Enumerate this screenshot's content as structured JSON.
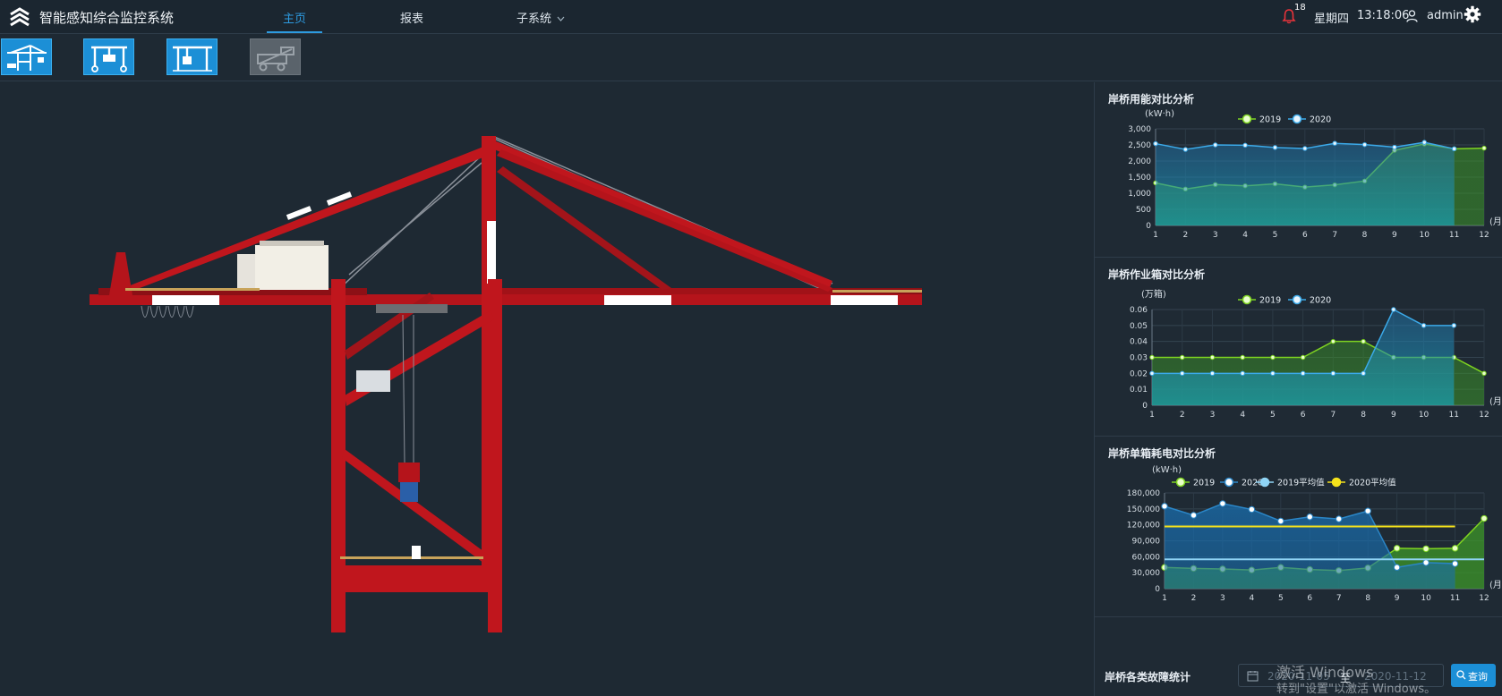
{
  "header": {
    "app_title": "智能感知综合监控系统",
    "nav": [
      {
        "label": "主页"
      },
      {
        "label": "报表"
      },
      {
        "label": "子系统"
      }
    ],
    "alert_count": "18",
    "weekday": "星期四",
    "time": "13:18:06",
    "username": "admin"
  },
  "toolbar": {
    "buttons": [
      {
        "icon": "quay-crane-icon",
        "state": "active"
      },
      {
        "icon": "gantry-crane-icon",
        "state": "active"
      },
      {
        "icon": "rail-gantry-icon",
        "state": "active"
      },
      {
        "icon": "reach-stacker-icon",
        "state": "disabled"
      }
    ]
  },
  "panels": {
    "energy": {
      "title": "岸桥用能对比分析"
    },
    "boxes": {
      "title": "岸桥作业箱对比分析"
    },
    "per_box": {
      "title": "岸桥单箱耗电对比分析"
    },
    "faults": {
      "title": "岸桥各类故障统计"
    }
  },
  "date_range": {
    "start": "2020-11-05",
    "separator": "至",
    "end": "2020-11-12"
  },
  "query_button": "查询",
  "watermark": {
    "line1": "激活 Windows",
    "line2": "转到\"设置\"以激活 Windows。"
  },
  "colors": {
    "accent": "#2d9be0",
    "series_2019": "#7ed321",
    "series_2020": "#3ba9e8",
    "avg_2019": "#8fd4f5",
    "avg_2020": "#f5e21b",
    "crane_red": "#c0161d"
  },
  "chart_data": [
    {
      "type": "area",
      "title": "岸桥用能对比分析",
      "ylabel": "(kW·h)",
      "xlabel": "(月)",
      "categories": [
        "1",
        "2",
        "3",
        "4",
        "5",
        "6",
        "7",
        "8",
        "9",
        "10",
        "11",
        "12"
      ],
      "ylim": [
        0,
        3000
      ],
      "yticks": [
        "0",
        "500",
        "1,000",
        "1,500",
        "2,000",
        "2,500",
        "3,000"
      ],
      "grid": true,
      "legend": "top-center",
      "series": [
        {
          "name": "2019",
          "values": [
            1320,
            1130,
            1270,
            1230,
            1290,
            1190,
            1260,
            1380,
            2330,
            2530,
            2380,
            2400
          ]
        },
        {
          "name": "2020",
          "values": [
            2540,
            2360,
            2500,
            2490,
            2420,
            2390,
            2550,
            2510,
            2430,
            2580,
            2380,
            null
          ]
        }
      ]
    },
    {
      "type": "area",
      "title": "岸桥作业箱对比分析",
      "ylabel": "(万箱)",
      "xlabel": "(月)",
      "categories": [
        "1",
        "2",
        "3",
        "4",
        "5",
        "6",
        "7",
        "8",
        "9",
        "10",
        "11",
        "12"
      ],
      "ylim": [
        0,
        0.06
      ],
      "yticks": [
        "0",
        "0.01",
        "0.02",
        "0.03",
        "0.04",
        "0.05",
        "0.06"
      ],
      "grid": true,
      "legend": "top-center",
      "series": [
        {
          "name": "2019",
          "values": [
            0.03,
            0.03,
            0.03,
            0.03,
            0.03,
            0.03,
            0.04,
            0.04,
            0.03,
            0.03,
            0.03,
            0.02
          ]
        },
        {
          "name": "2020",
          "values": [
            0.02,
            0.02,
            0.02,
            0.02,
            0.02,
            0.02,
            0.02,
            0.02,
            0.06,
            0.05,
            0.05,
            null
          ]
        }
      ]
    },
    {
      "type": "area",
      "title": "岸桥单箱耗电对比分析",
      "ylabel": "(kW·h)",
      "xlabel": "(月)",
      "categories": [
        "1",
        "2",
        "3",
        "4",
        "5",
        "6",
        "7",
        "8",
        "9",
        "10",
        "11",
        "12"
      ],
      "ylim": [
        0,
        180000
      ],
      "yticks": [
        "0",
        "30,000",
        "60,000",
        "90,000",
        "120,000",
        "150,000",
        "180,000"
      ],
      "grid": true,
      "legend": "top-center",
      "series": [
        {
          "name": "2019",
          "values": [
            40000,
            38000,
            37000,
            35000,
            40000,
            36000,
            34000,
            39000,
            76000,
            75000,
            76000,
            132000
          ]
        },
        {
          "name": "2020",
          "values": [
            155000,
            138000,
            160000,
            149000,
            127000,
            135000,
            131000,
            146000,
            40000,
            49000,
            47000,
            null
          ]
        },
        {
          "name": "2019平均值",
          "values": [
            55000,
            55000,
            55000,
            55000,
            55000,
            55000,
            55000,
            55000,
            55000,
            55000,
            55000,
            55000
          ]
        },
        {
          "name": "2020平均值",
          "values": [
            117000,
            117000,
            117000,
            117000,
            117000,
            117000,
            117000,
            117000,
            117000,
            117000,
            117000,
            null
          ]
        }
      ]
    }
  ]
}
